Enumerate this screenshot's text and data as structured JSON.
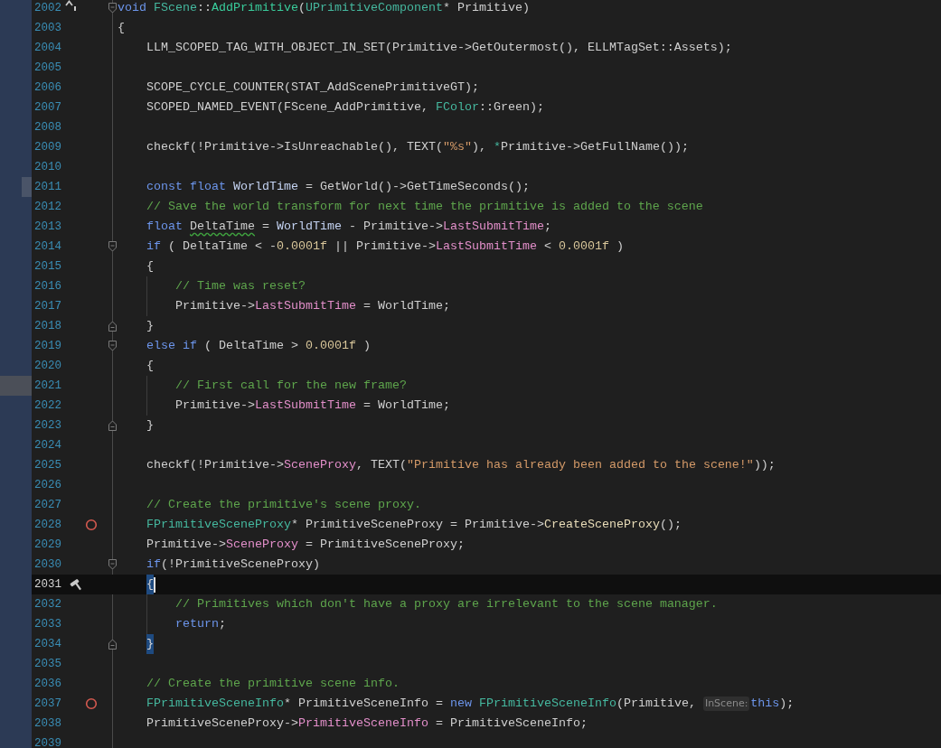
{
  "editor": {
    "lines": [
      {
        "number": "2002",
        "current": false,
        "indent_guide": false,
        "indent": {
          "kind": "none"
        },
        "gutter_icon": {
          "kind": "override"
        },
        "fold": {
          "kind": "start"
        },
        "tokens": [
          {
            "kind": "kw",
            "text": "void "
          },
          {
            "kind": "type",
            "text": "FScene"
          },
          {
            "kind": "plain",
            "text": "::"
          },
          {
            "kind": "func",
            "text": "AddPrimitive"
          },
          {
            "kind": "plain",
            "text": "("
          },
          {
            "kind": "type",
            "text": "UPrimitiveComponent"
          },
          {
            "kind": "plain",
            "text": "* Primitive)"
          }
        ]
      },
      {
        "number": "2003",
        "current": false,
        "indent_guide": false,
        "indent": {
          "kind": "none"
        },
        "tokens": [
          {
            "kind": "plain",
            "text": "{"
          }
        ]
      },
      {
        "number": "2004",
        "current": false,
        "indent_guide": false,
        "indent": {
          "kind": "block"
        },
        "tokens": [
          {
            "kind": "plain",
            "text": "LLM_SCOPED_TAG_WITH_OBJECT_IN_SET(Primitive->GetOutermost(), ELLMTagSet::Assets);"
          }
        ]
      },
      {
        "number": "2005",
        "current": false,
        "indent_guide": false
      },
      {
        "number": "2006",
        "current": false,
        "indent_guide": false,
        "indent": {
          "kind": "block"
        },
        "tokens": [
          {
            "kind": "plain",
            "text": "SCOPE_CYCLE_COUNTER(STAT_AddScenePrimitiveGT);"
          }
        ]
      },
      {
        "number": "2007",
        "current": false,
        "indent_guide": false,
        "indent": {
          "kind": "block"
        },
        "tokens": [
          {
            "kind": "plain",
            "text": "SCOPED_NAMED_EVENT(FScene_AddPrimitive, "
          },
          {
            "kind": "type",
            "text": "FColor"
          },
          {
            "kind": "plain",
            "text": "::Green);"
          }
        ]
      },
      {
        "number": "2008",
        "current": false,
        "indent_guide": false
      },
      {
        "number": "2009",
        "current": false,
        "indent_guide": false,
        "indent": {
          "kind": "block"
        },
        "tokens": [
          {
            "kind": "plain",
            "text": "checkf(!Primitive->IsUnreachable(), TEXT("
          },
          {
            "kind": "string",
            "text": "\"%s\""
          },
          {
            "kind": "plain",
            "text": "), "
          },
          {
            "kind": "type",
            "text": "*"
          },
          {
            "kind": "plain",
            "text": "Primitive->GetFullName());"
          }
        ]
      },
      {
        "number": "2010",
        "current": false,
        "indent_guide": false
      },
      {
        "number": "2011",
        "current": false,
        "indent_guide": false,
        "indent": {
          "kind": "block"
        },
        "marker": {
          "kind": "narrow"
        },
        "tokens": [
          {
            "kind": "kw",
            "text": "const float "
          },
          {
            "kind": "local",
            "text": "WorldTime"
          },
          {
            "kind": "plain",
            "text": " = GetWorld()->GetTimeSeconds();"
          }
        ]
      },
      {
        "number": "2012",
        "current": false,
        "indent_guide": false,
        "indent": {
          "kind": "block"
        },
        "tokens": [
          {
            "kind": "comment",
            "text": "// Save the world transform for next time the primitive is added to the scene"
          }
        ]
      },
      {
        "number": "2013",
        "current": false,
        "indent_guide": false,
        "indent": {
          "kind": "block"
        },
        "tokens": [
          {
            "kind": "kw",
            "text": "float "
          },
          {
            "kind": "warning",
            "text": "DeltaTime"
          },
          {
            "kind": "plain",
            "text": " = "
          },
          {
            "kind": "local",
            "text": "WorldTime"
          },
          {
            "kind": "plain",
            "text": " - Primitive->"
          },
          {
            "kind": "field",
            "text": "LastSubmitTime"
          },
          {
            "kind": "plain",
            "text": ";"
          }
        ]
      },
      {
        "number": "2014",
        "current": false,
        "indent_guide": false,
        "indent": {
          "kind": "block"
        },
        "fold": {
          "kind": "start"
        },
        "tokens": [
          {
            "kind": "kw",
            "text": "if"
          },
          {
            "kind": "plain",
            "text": " ( DeltaTime < -"
          },
          {
            "kind": "number",
            "text": "0.0001f"
          },
          {
            "kind": "plain",
            "text": " || Primitive->"
          },
          {
            "kind": "field",
            "text": "LastSubmitTime"
          },
          {
            "kind": "plain",
            "text": " < "
          },
          {
            "kind": "number",
            "text": "0.0001f"
          },
          {
            "kind": "plain",
            "text": " )"
          }
        ]
      },
      {
        "number": "2015",
        "current": false,
        "indent_guide": false,
        "indent": {
          "kind": "block"
        },
        "tokens": [
          {
            "kind": "plain",
            "text": "{"
          }
        ]
      },
      {
        "number": "2016",
        "current": false,
        "indent_guide": true,
        "indent": {
          "kind": "nested"
        },
        "tokens": [
          {
            "kind": "comment",
            "text": "// Time was reset?"
          }
        ]
      },
      {
        "number": "2017",
        "current": false,
        "indent_guide": true,
        "indent": {
          "kind": "nested"
        },
        "tokens": [
          {
            "kind": "plain",
            "text": "Primitive->"
          },
          {
            "kind": "field",
            "text": "LastSubmitTime"
          },
          {
            "kind": "plain",
            "text": " = WorldTime;"
          }
        ]
      },
      {
        "number": "2018",
        "current": false,
        "indent_guide": false,
        "indent": {
          "kind": "block"
        },
        "fold": {
          "kind": "end"
        },
        "tokens": [
          {
            "kind": "plain",
            "text": "}"
          }
        ]
      },
      {
        "number": "2019",
        "current": false,
        "indent_guide": false,
        "indent": {
          "kind": "block"
        },
        "fold": {
          "kind": "start"
        },
        "tokens": [
          {
            "kind": "kw",
            "text": "else if"
          },
          {
            "kind": "plain",
            "text": " ( DeltaTime > "
          },
          {
            "kind": "number",
            "text": "0.0001f"
          },
          {
            "kind": "plain",
            "text": " )"
          }
        ]
      },
      {
        "number": "2020",
        "current": false,
        "indent_guide": false,
        "indent": {
          "kind": "block"
        },
        "tokens": [
          {
            "kind": "plain",
            "text": "{"
          }
        ]
      },
      {
        "number": "2021",
        "current": false,
        "indent_guide": true,
        "indent": {
          "kind": "nested"
        },
        "marker": {
          "kind": "wide"
        },
        "tokens": [
          {
            "kind": "comment",
            "text": "// First call for the new frame?"
          }
        ]
      },
      {
        "number": "2022",
        "current": false,
        "indent_guide": true,
        "indent": {
          "kind": "nested"
        },
        "tokens": [
          {
            "kind": "plain",
            "text": "Primitive->"
          },
          {
            "kind": "field",
            "text": "LastSubmitTime"
          },
          {
            "kind": "plain",
            "text": " = WorldTime;"
          }
        ]
      },
      {
        "number": "2023",
        "current": false,
        "indent_guide": false,
        "indent": {
          "kind": "block"
        },
        "fold": {
          "kind": "end"
        },
        "tokens": [
          {
            "kind": "plain",
            "text": "}"
          }
        ]
      },
      {
        "number": "2024",
        "current": false,
        "indent_guide": false
      },
      {
        "number": "2025",
        "current": false,
        "indent_guide": false,
        "indent": {
          "kind": "block"
        },
        "tokens": [
          {
            "kind": "plain",
            "text": "checkf(!Primitive->"
          },
          {
            "kind": "field",
            "text": "SceneProxy"
          },
          {
            "kind": "plain",
            "text": ", TEXT("
          },
          {
            "kind": "string",
            "text": "\"Primitive has already been added to the scene!\""
          },
          {
            "kind": "plain",
            "text": "));"
          }
        ]
      },
      {
        "number": "2026",
        "current": false,
        "indent_guide": false
      },
      {
        "number": "2027",
        "current": false,
        "indent_guide": false,
        "indent": {
          "kind": "block"
        },
        "tokens": [
          {
            "kind": "comment",
            "text": "// Create the primitive's scene proxy."
          }
        ]
      },
      {
        "number": "2028",
        "current": false,
        "indent_guide": false,
        "indent": {
          "kind": "block"
        },
        "gutter_icon": {
          "kind": "breakpoint"
        },
        "tokens": [
          {
            "kind": "type",
            "text": "FPrimitiveSceneProxy"
          },
          {
            "kind": "plain",
            "text": "* PrimitiveSceneProxy = Primitive->"
          },
          {
            "kind": "method",
            "text": "CreateSceneProxy"
          },
          {
            "kind": "plain",
            "text": "();"
          }
        ]
      },
      {
        "number": "2029",
        "current": false,
        "indent_guide": false,
        "indent": {
          "kind": "block"
        },
        "tokens": [
          {
            "kind": "plain",
            "text": "Primitive->"
          },
          {
            "kind": "field",
            "text": "SceneProxy"
          },
          {
            "kind": "plain",
            "text": " = PrimitiveSceneProxy;"
          }
        ]
      },
      {
        "number": "2030",
        "current": false,
        "indent_guide": false,
        "indent": {
          "kind": "block"
        },
        "fold": {
          "kind": "start"
        },
        "tokens": [
          {
            "kind": "kw",
            "text": "if"
          },
          {
            "kind": "plain",
            "text": "(!PrimitiveSceneProxy)"
          }
        ]
      },
      {
        "number": "2031",
        "current": true,
        "indent_guide": false,
        "indent": {
          "kind": "block"
        },
        "gutter_icon": {
          "kind": "hammer"
        },
        "caret": true,
        "tokens": [
          {
            "kind": "brace",
            "text": "{"
          }
        ]
      },
      {
        "number": "2032",
        "current": false,
        "indent_guide": true,
        "indent": {
          "kind": "nested"
        },
        "tokens": [
          {
            "kind": "comment",
            "text": "// Primitives which don't have a proxy are irrelevant to the scene manager."
          }
        ]
      },
      {
        "number": "2033",
        "current": false,
        "indent_guide": true,
        "indent": {
          "kind": "nested"
        },
        "tokens": [
          {
            "kind": "kw",
            "text": "return"
          },
          {
            "kind": "plain",
            "text": ";"
          }
        ]
      },
      {
        "number": "2034",
        "current": false,
        "indent_guide": false,
        "indent": {
          "kind": "block"
        },
        "fold": {
          "kind": "end"
        },
        "tokens": [
          {
            "kind": "brace",
            "text": "}"
          }
        ]
      },
      {
        "number": "2035",
        "current": false,
        "indent_guide": false
      },
      {
        "number": "2036",
        "current": false,
        "indent_guide": false,
        "indent": {
          "kind": "block"
        },
        "tokens": [
          {
            "kind": "comment",
            "text": "// Create the primitive scene info."
          }
        ]
      },
      {
        "number": "2037",
        "current": false,
        "indent_guide": false,
        "indent": {
          "kind": "block"
        },
        "gutter_icon": {
          "kind": "breakpoint"
        },
        "tokens": [
          {
            "kind": "type",
            "text": "FPrimitiveSceneInfo"
          },
          {
            "kind": "plain",
            "text": "* PrimitiveSceneInfo = "
          },
          {
            "kind": "kw",
            "text": "new "
          },
          {
            "kind": "type",
            "text": "FPrimitiveSceneInfo"
          },
          {
            "kind": "plain",
            "text": "(Primitive, "
          },
          {
            "kind": "hint",
            "text": "InScene:"
          },
          {
            "kind": "kw",
            "text": "this"
          },
          {
            "kind": "plain",
            "text": ");"
          }
        ]
      },
      {
        "number": "2038",
        "current": false,
        "indent_guide": false,
        "indent": {
          "kind": "block"
        },
        "tokens": [
          {
            "kind": "plain",
            "text": "PrimitiveSceneProxy->"
          },
          {
            "kind": "field",
            "text": "PrimitiveSceneInfo"
          },
          {
            "kind": "plain",
            "text": " = PrimitiveSceneInfo;"
          }
        ]
      },
      {
        "number": "2039",
        "current": false,
        "indent_guide": false
      }
    ]
  }
}
